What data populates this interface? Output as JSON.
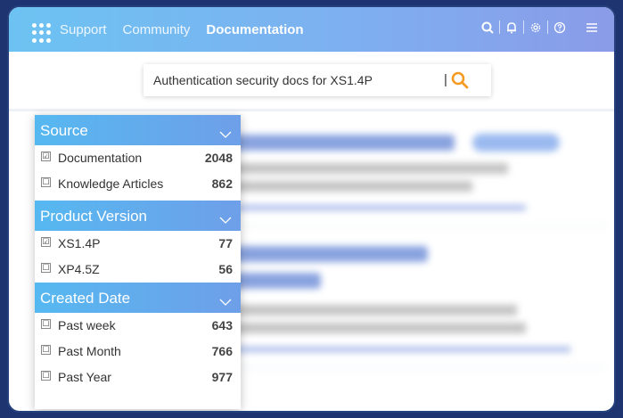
{
  "topbar": {
    "nav": [
      {
        "label": "Support",
        "active": false
      },
      {
        "label": "Community",
        "active": false
      },
      {
        "label": "Documentation",
        "active": true
      }
    ],
    "icons": [
      "search-icon",
      "bell-icon",
      "gear-icon",
      "help-icon",
      "menu-icon"
    ]
  },
  "search": {
    "query": "Authentication security docs for XS1.4P",
    "caret": "|"
  },
  "filters": {
    "source": {
      "title": "Source",
      "items": [
        {
          "label": "Documentation",
          "count": "2048",
          "checked": true,
          "mark": "☑"
        },
        {
          "label": "Knowledge Articles",
          "count": "862",
          "checked": false,
          "mark": "☐"
        }
      ]
    },
    "version": {
      "title": "Product Version",
      "items": [
        {
          "label": "XS1.4P",
          "count": "77",
          "checked": true,
          "mark": "☑"
        },
        {
          "label": "XP4.5Z",
          "count": "56",
          "checked": false,
          "mark": "☐"
        }
      ]
    },
    "date": {
      "title": "Created Date",
      "items": [
        {
          "label": "Past week",
          "count": "643",
          "checked": false,
          "mark": "☐"
        },
        {
          "label": "Past Month",
          "count": "766",
          "checked": false,
          "mark": "☐"
        },
        {
          "label": "Past Year",
          "count": "977",
          "checked": false,
          "mark": "☐"
        }
      ]
    }
  },
  "colors": {
    "accent": "#f59a23",
    "header_start": "#6cc3f2",
    "header_end": "#8a9be8",
    "frame": "#1e3470"
  }
}
